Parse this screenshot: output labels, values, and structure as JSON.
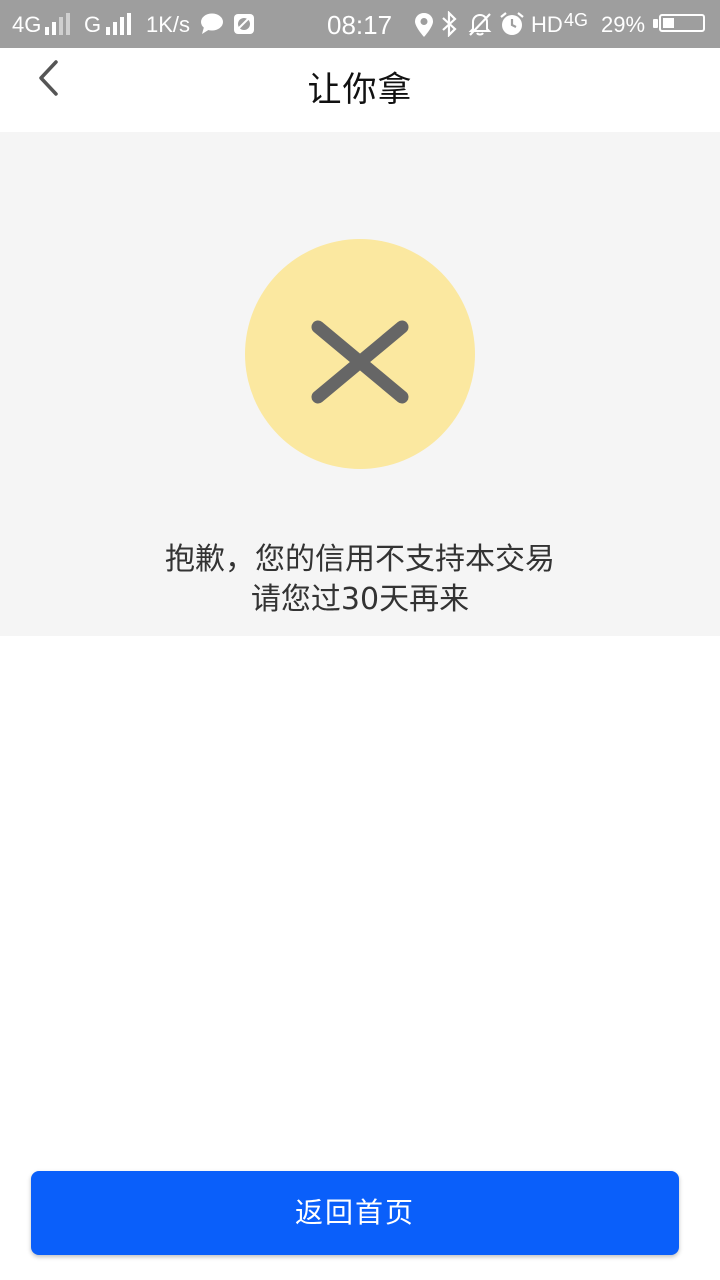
{
  "status_bar": {
    "network1": "4G",
    "network2": "G",
    "speed": "1K/s",
    "time": "08:17",
    "hd": "HD",
    "network3": "4G",
    "battery": "29%",
    "battery_level": 0.29,
    "icons": [
      "signal-icon",
      "chat-icon",
      "gallery-icon",
      "location-icon",
      "bluetooth-icon",
      "mute-icon",
      "alarm-icon",
      "battery-icon"
    ]
  },
  "header": {
    "title": "让你拿",
    "back_icon": "chevron-left-icon"
  },
  "result": {
    "icon": "close-icon",
    "circle_color": "#fbe8a0",
    "line1": "抱歉，您的信用不支持本交易",
    "line2": "请您过30天再来"
  },
  "footer": {
    "home_label": "返回首页",
    "accent_color": "#0a5ffa"
  }
}
